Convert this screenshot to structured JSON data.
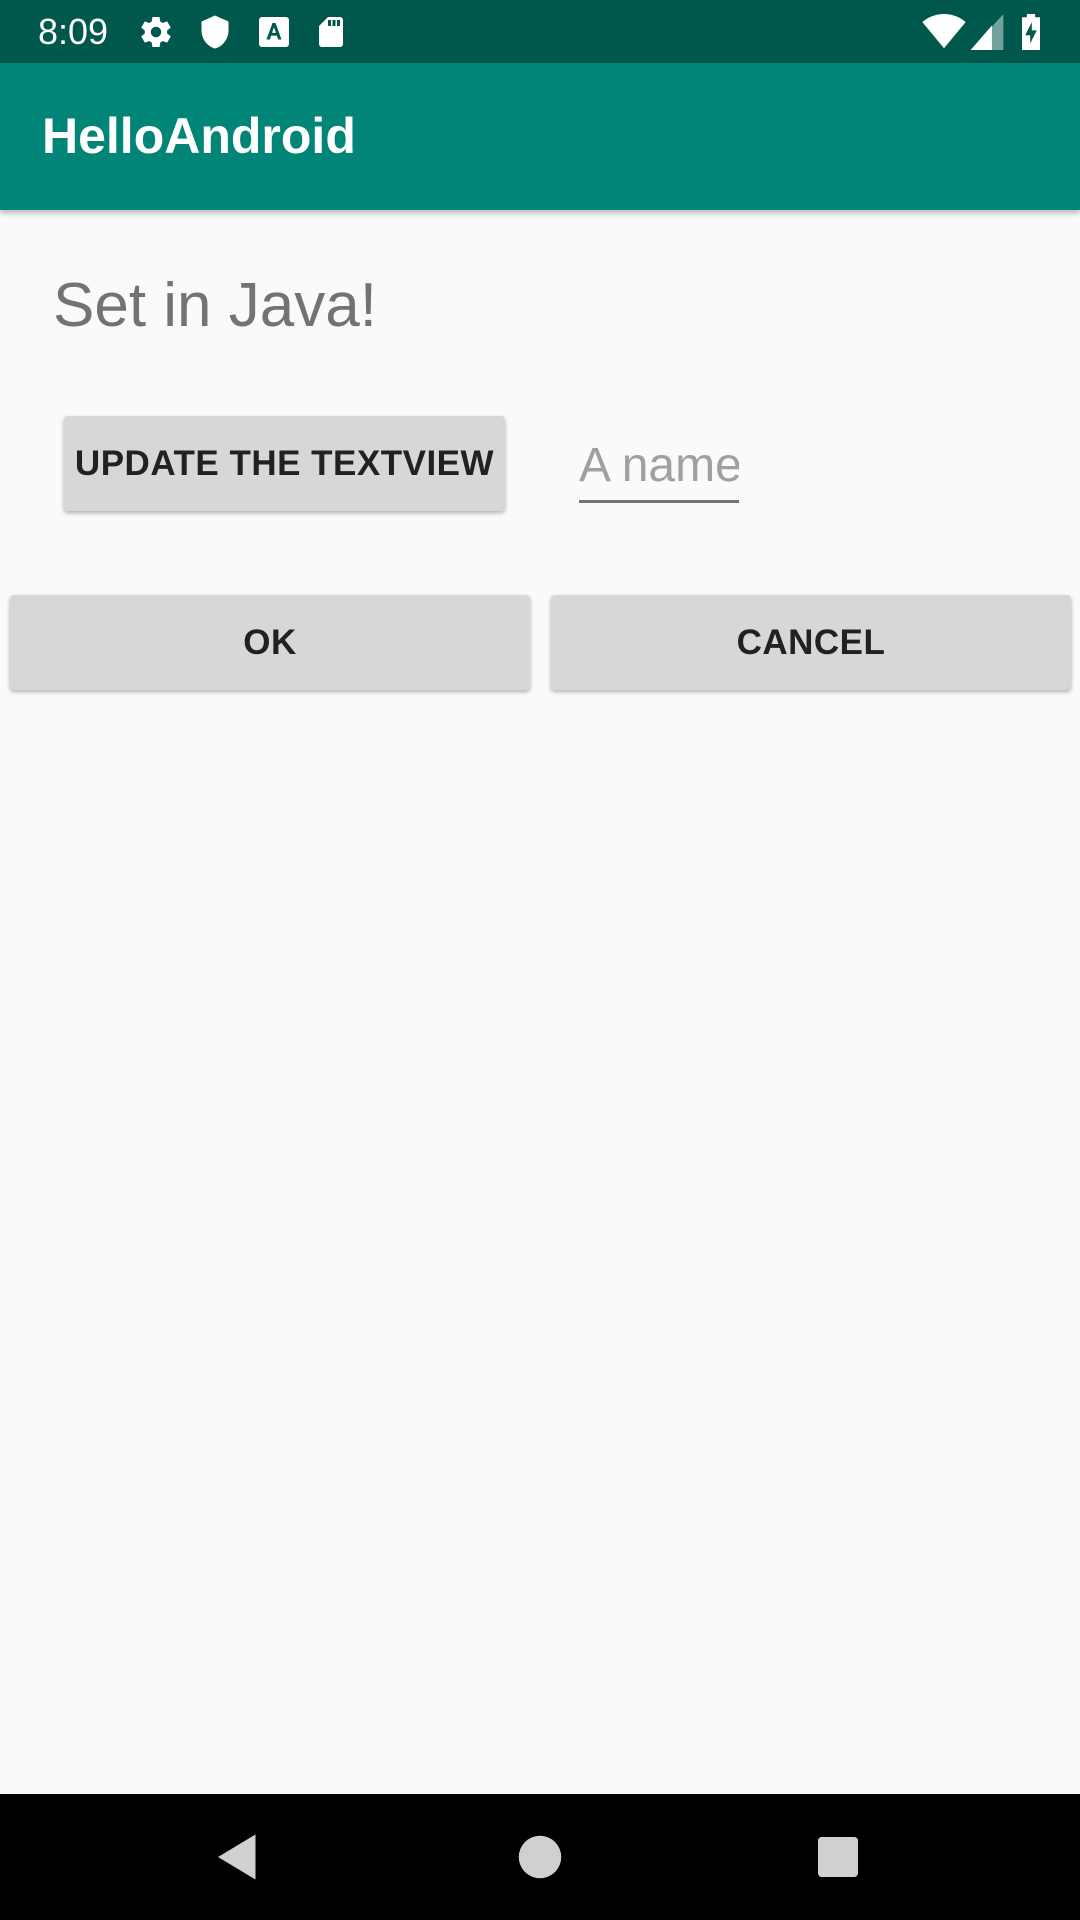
{
  "status_bar": {
    "time": "8:09",
    "left_icons": [
      "gear-icon",
      "shield-icon",
      "font-download-icon",
      "sd-card-icon"
    ],
    "right_icons": [
      "wifi-icon",
      "cell-signal-icon",
      "battery-charging-icon"
    ]
  },
  "app_bar": {
    "title": "HelloAndroid",
    "color": "#008577",
    "status_color": "#00574b"
  },
  "main": {
    "text_view": "Set in Java!",
    "update_button_label": "UPDATE THE TEXTVIEW",
    "name_input": {
      "placeholder": "A name",
      "value": ""
    },
    "ok_button_label": "OK",
    "cancel_button_label": "CANCEL"
  },
  "nav_bar": {
    "buttons": [
      "back-icon",
      "home-icon",
      "recents-icon"
    ]
  }
}
